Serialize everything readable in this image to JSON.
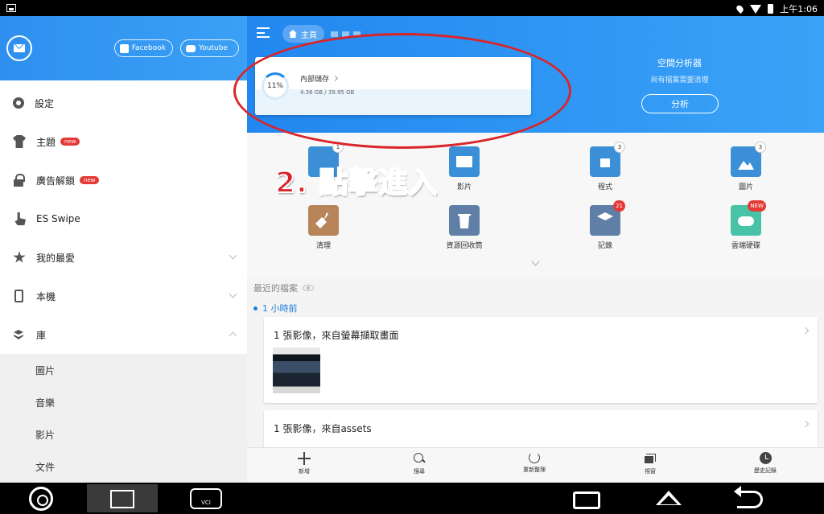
{
  "status_bar": {
    "time": "上午1:06"
  },
  "sidebar": {
    "facebook_label": "Facebook",
    "youtube_label": "Youtube",
    "items": [
      {
        "label": "設定",
        "icon": "gear-icon"
      },
      {
        "label": "主題",
        "icon": "shirt-icon",
        "badge": "new"
      },
      {
        "label": "廣告解鎖",
        "icon": "lock-icon",
        "badge": "new"
      },
      {
        "label": "ES Swipe",
        "icon": "swipe-hand-icon"
      },
      {
        "label": "我的最愛",
        "icon": "star-icon"
      },
      {
        "label": "本機",
        "icon": "phone-icon"
      },
      {
        "label": "庫",
        "icon": "layers-icon"
      }
    ],
    "library_sub": [
      "圖片",
      "音樂",
      "影片",
      "文件"
    ]
  },
  "header": {
    "breadcrumb": "主頁"
  },
  "storage": {
    "percent_label": "11%",
    "percent": 11,
    "name": "內部儲存",
    "size": "4.36 GB / 39.95 GB"
  },
  "analyzer": {
    "title": "空間分析器",
    "subtitle": "尚有檔案需要清理",
    "button": "分析"
  },
  "annotation": "2. 點擊進入",
  "grid": {
    "row1": [
      {
        "label": "",
        "badge": "1",
        "color": "#3a8fd6"
      },
      {
        "label": "影片",
        "badge": "",
        "color": "#3a8fd6"
      },
      {
        "label": "程式",
        "badge": "3",
        "color": "#3a8fd6"
      },
      {
        "label": "圖片",
        "badge": "3",
        "color": "#3a8fd6"
      }
    ],
    "row2": [
      {
        "label": "清理",
        "badge": "",
        "color": "#b8845a"
      },
      {
        "label": "資源回收筒",
        "badge": "",
        "color": "#5f7fa6"
      },
      {
        "label": "記錄",
        "badge": "21",
        "color": "#5f7fa6"
      },
      {
        "label": "雲端硬碟",
        "badge": "NEW",
        "color": "#48c3a8"
      }
    ]
  },
  "recent": {
    "title": "最近的檔案",
    "time_group": "1 小時前",
    "cards": [
      {
        "title": "1 張影像，來自螢幕擷取畫面"
      },
      {
        "title": "1 張影像，來自assets"
      }
    ]
  },
  "toolbar": {
    "new": "新增",
    "search": "搜尋",
    "refresh": "重新整理",
    "windows": "視窗",
    "history": "歷史記錄"
  },
  "navbar": {
    "vci_label": "VCI"
  }
}
